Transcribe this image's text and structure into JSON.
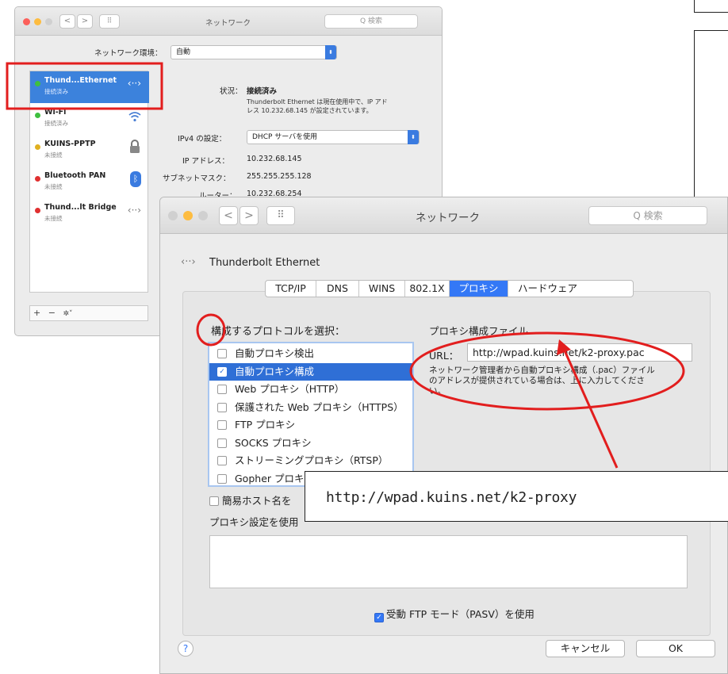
{
  "back_window": {
    "title": "ネットワーク",
    "search_placeholder": "Q 検索",
    "location_label": "ネットワーク環境：",
    "location_value": "自動",
    "services": [
      {
        "name": "Thund...Ethernet",
        "status": "接続済み",
        "color": "#3fbf3f",
        "icon": "ethernet-icon"
      },
      {
        "name": "Wi-Fi",
        "status": "接続済み",
        "color": "#3fbf3f",
        "icon": "wifi-icon"
      },
      {
        "name": "KUINS-PPTP",
        "status": "未接続",
        "color": "#e0b020",
        "icon": "lock-icon"
      },
      {
        "name": "Bluetooth PAN",
        "status": "未接続",
        "color": "#e03030",
        "icon": "bluetooth-icon"
      },
      {
        "name": "Thund...lt Bridge",
        "status": "未接続",
        "color": "#e03030",
        "icon": "ethernet-icon"
      }
    ],
    "status_label": "状況：",
    "status_value": "接続済み",
    "status_desc_1": "Thunderbolt Ethernet は現在使用中で、IP アド",
    "status_desc_2": "レス 10.232.68.145 が設定されています。",
    "ipv4_label": "IPv4 の設定：",
    "ipv4_value": "DHCP サーバを使用",
    "ip_label": "IP アドレス：",
    "ip_value": "10.232.68.145",
    "subnet_label": "サブネットマスク：",
    "subnet_value": "255.255.255.128",
    "router_label": "ルーター：",
    "router_value": "10.232.68.254",
    "bottom_controls": [
      "+",
      "−",
      "✲˅"
    ]
  },
  "front_window": {
    "title": "ネットワーク",
    "search_placeholder": "Q 検索",
    "interface_name": "Thunderbolt Ethernet",
    "tabs": [
      "TCP/IP",
      "DNS",
      "WINS",
      "802.1X",
      "プロキシ",
      "ハードウェア"
    ],
    "active_tab": "プロキシ",
    "protocol_heading": "構成するプロトコルを選択：",
    "protocols": [
      {
        "label": "自動プロキシ検出",
        "checked": false
      },
      {
        "label": "自動プロキシ構成",
        "checked": true
      },
      {
        "label": "Web プロキシ（HTTP）",
        "checked": false
      },
      {
        "label": "保護された Web プロキシ（HTTPS）",
        "checked": false
      },
      {
        "label": "FTP プロキシ",
        "checked": false
      },
      {
        "label": "SOCKS プロキシ",
        "checked": false
      },
      {
        "label": "ストリーミングプロキシ（RTSP）",
        "checked": false
      },
      {
        "label": "Gopher プロキシ",
        "checked": false
      }
    ],
    "config_heading": "プロキシ構成ファイル",
    "url_label": "URL：",
    "url_value": "http://wpad.kuins.net/k2-proxy.pac",
    "url_help_1": "ネットワーク管理者から自動プロキシ構成（.pac）ファイル",
    "url_help_2": "のアドレスが提供されている場合は、上に入力してくださ",
    "url_help_3": "い。",
    "simple_host_label": "簡易ホスト名を",
    "bypass_label": "プロキシ設定を使用",
    "pasv_label": "受動 FTP モード（PASV）を使用",
    "pasv_checked": true,
    "help_button": "?",
    "cancel_button": "キャンセル",
    "ok_button": "OK"
  },
  "callout": {
    "text": "http://wpad.kuins.net/k2-proxy"
  },
  "colors": {
    "annotation_red": "#e21e1e",
    "accent_blue": "#3478f6"
  }
}
